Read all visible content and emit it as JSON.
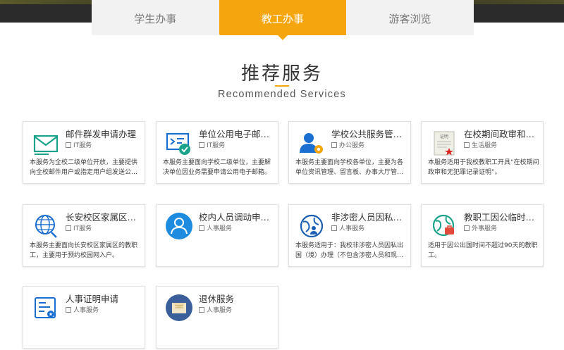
{
  "tabs": [
    {
      "label": "学生办事",
      "active": false
    },
    {
      "label": "教工办事",
      "active": true
    },
    {
      "label": "游客浏览",
      "active": false
    }
  ],
  "section": {
    "title": "推荐服务",
    "subtitle": "Recommended Services"
  },
  "colors": {
    "accent": "#f5a60e",
    "teal": "#1aa38a",
    "blue": "#1a6fd1"
  },
  "cards": [
    {
      "name": "邮件群发申请办理",
      "category": "IT服务",
      "desc": "本服务为全校二级单位开放，主要提供向全校邮件用户或指定用户组发送公…",
      "icon": "mail-icon"
    },
    {
      "name": "单位公用电子邮…",
      "category": "IT服务",
      "desc": "本服务主要面向学校二级单位，主要解决单位因业务需要申请公用电子邮箱。",
      "icon": "mail-check-icon"
    },
    {
      "name": "学校公共服务管…",
      "category": "办公服务",
      "desc": "本服务主要面向学校各单位，主要为各单位资讯管理、留言板、办事大厅管…",
      "icon": "user-gear-icon"
    },
    {
      "name": "在校期间政审和…",
      "category": "生活服务",
      "desc": "本服务适用于我校教职工开具“在校期间政审和无犯罪记录证明”。",
      "icon": "certificate-icon"
    },
    {
      "name": "长安校区家属区…",
      "category": "IT服务",
      "desc": "本服务主要面向长安校区家属区的教职工，主要用于预约校园网入户。",
      "icon": "globe-icon"
    },
    {
      "name": "校内人员调动申…",
      "category": "人事服务",
      "desc": "",
      "icon": "person-icon"
    },
    {
      "name": "非涉密人员因私…",
      "category": "人事服务",
      "desc": "本服务适用于：我校非涉密人员因私出国（境）办理（不包含涉密人员和现…",
      "icon": "globe-person-icon"
    },
    {
      "name": "教职工因公临时…",
      "category": "外事服务",
      "desc": "适用于因公出国时间不超过90天的教职工。",
      "icon": "globe-briefcase-icon"
    },
    {
      "name": "人事证明申请",
      "category": "人事服务",
      "desc": "",
      "icon": "id-card-icon"
    },
    {
      "name": "退休服务",
      "category": "人事服务",
      "desc": "",
      "icon": "envelope-open-icon"
    }
  ]
}
